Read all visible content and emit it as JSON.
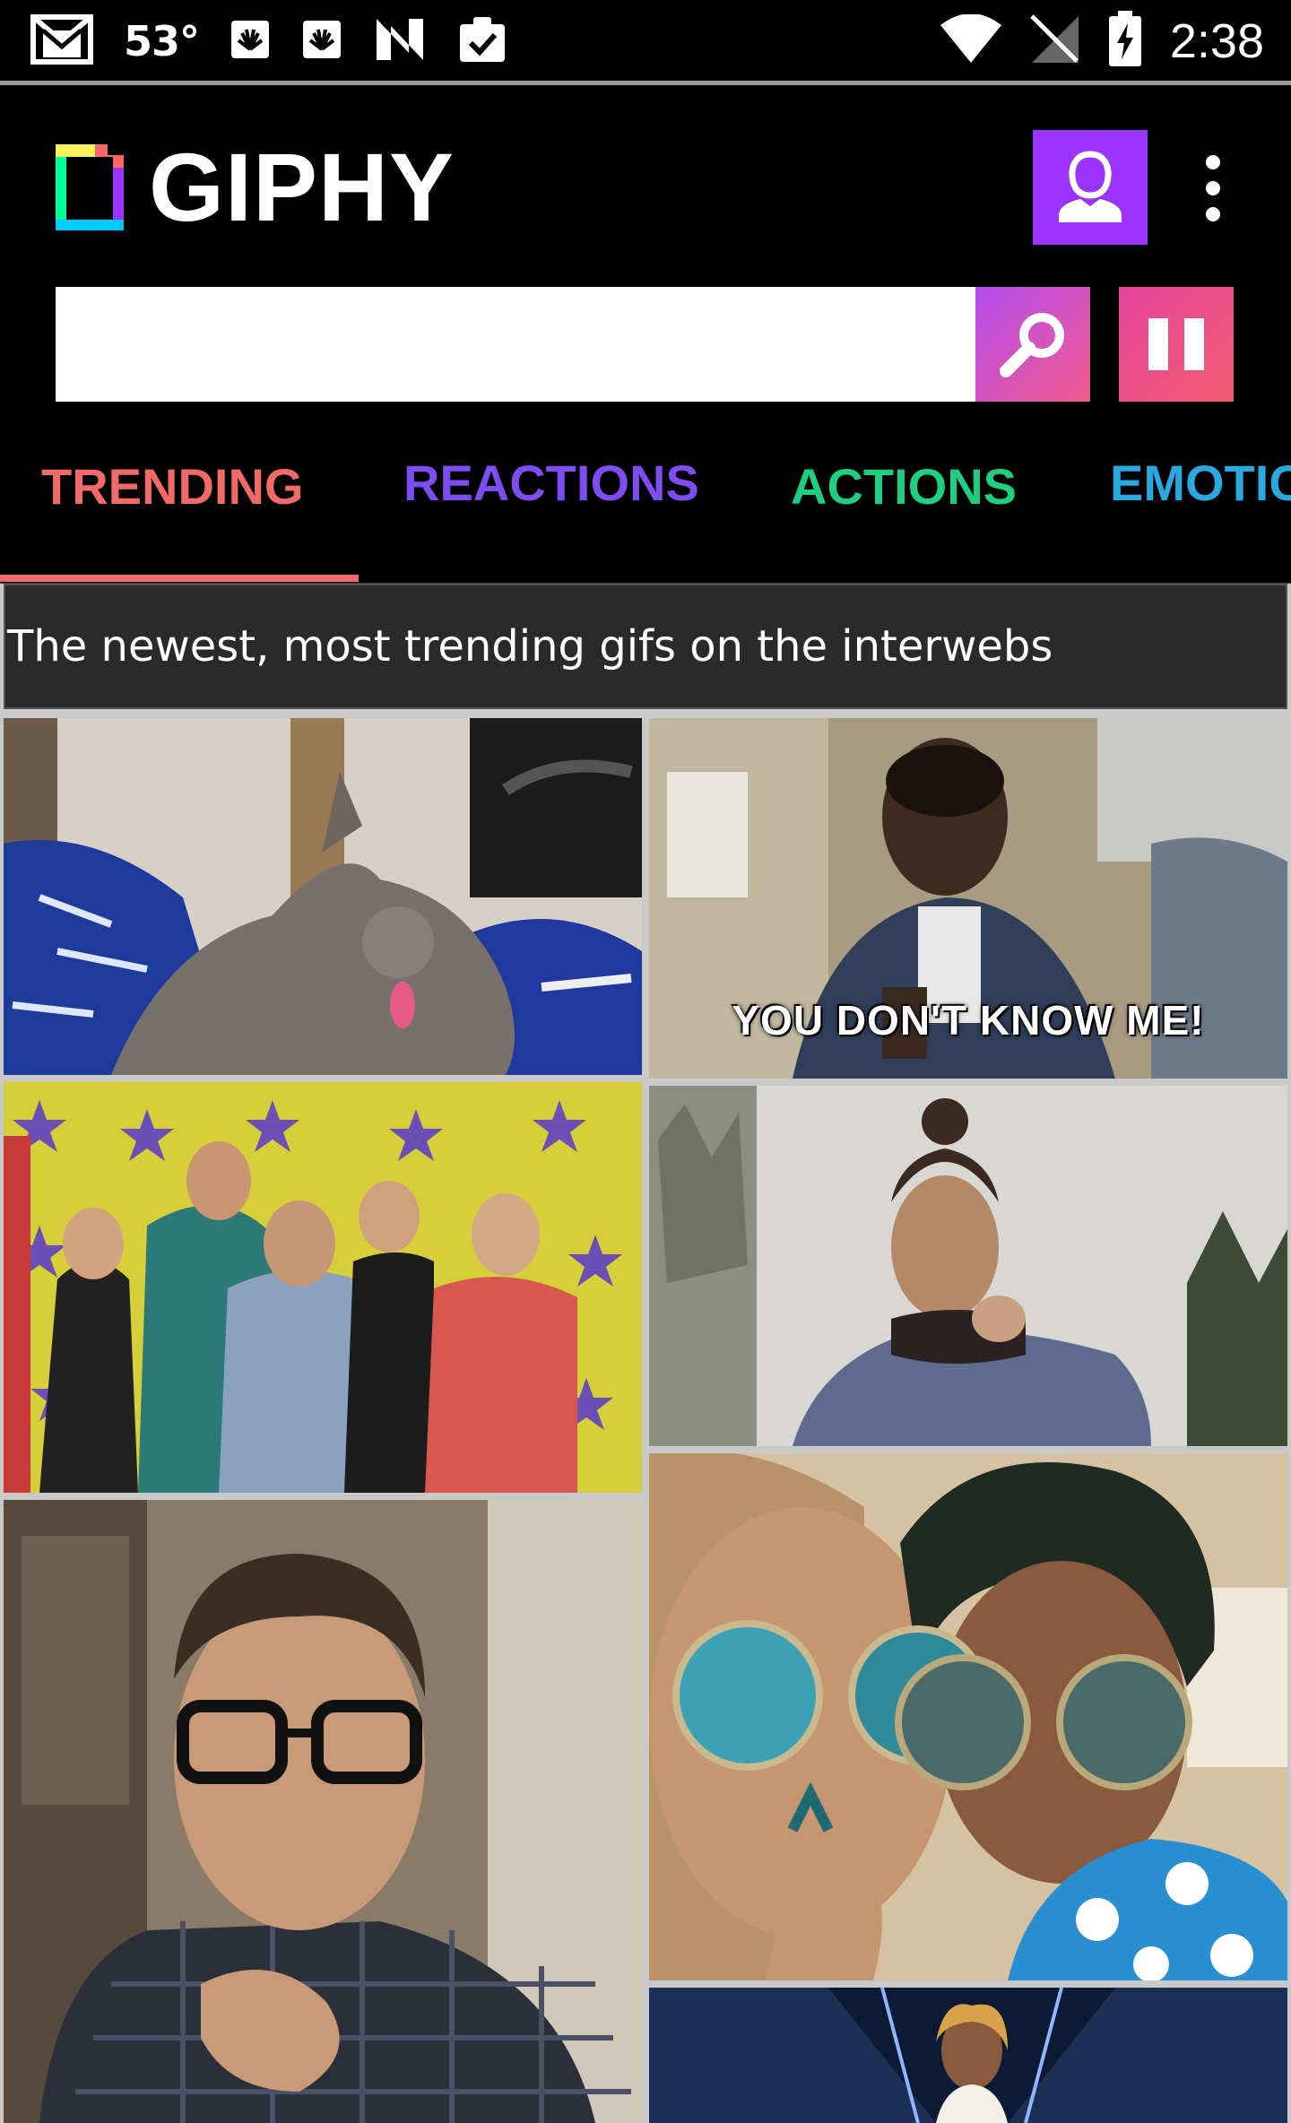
{
  "status_bar": {
    "temperature": "53°",
    "time": "2:38",
    "left_icons": [
      "gmail-icon",
      "huawei-icon",
      "huawei-icon",
      "n-icon",
      "clipboard-check-icon"
    ],
    "right_icons": [
      "wifi-icon",
      "no-signal-icon",
      "battery-charging-icon"
    ]
  },
  "header": {
    "logo_text": "GIPHY",
    "search": {
      "value": "",
      "placeholder": ""
    },
    "profile_color": "#9b33ff"
  },
  "tabs": [
    {
      "label": "TRENDING",
      "color": "#f26a68",
      "selected": true
    },
    {
      "label": "REACTIONS",
      "color": "#7e4cf0",
      "selected": false
    },
    {
      "label": "ACTIONS",
      "color": "#1ecf82",
      "selected": false
    },
    {
      "label": "EMOTIC",
      "color": "#29a9e0",
      "selected": false
    }
  ],
  "banner": {
    "text": "The newest, most trending gifs on the interwebs"
  },
  "gifs": [
    {
      "name": "gif-cat",
      "caption": ""
    },
    {
      "name": "gif-man-couch",
      "caption": "YOU DON'T KNOW ME!"
    },
    {
      "name": "gif-group-stars",
      "caption": ""
    },
    {
      "name": "gif-woman-outdoors",
      "caption": ""
    },
    {
      "name": "gif-man-glasses",
      "caption": ""
    },
    {
      "name": "gif-sunglasses-duo",
      "caption": ""
    },
    {
      "name": "gif-stage-performer",
      "caption": ""
    }
  ]
}
